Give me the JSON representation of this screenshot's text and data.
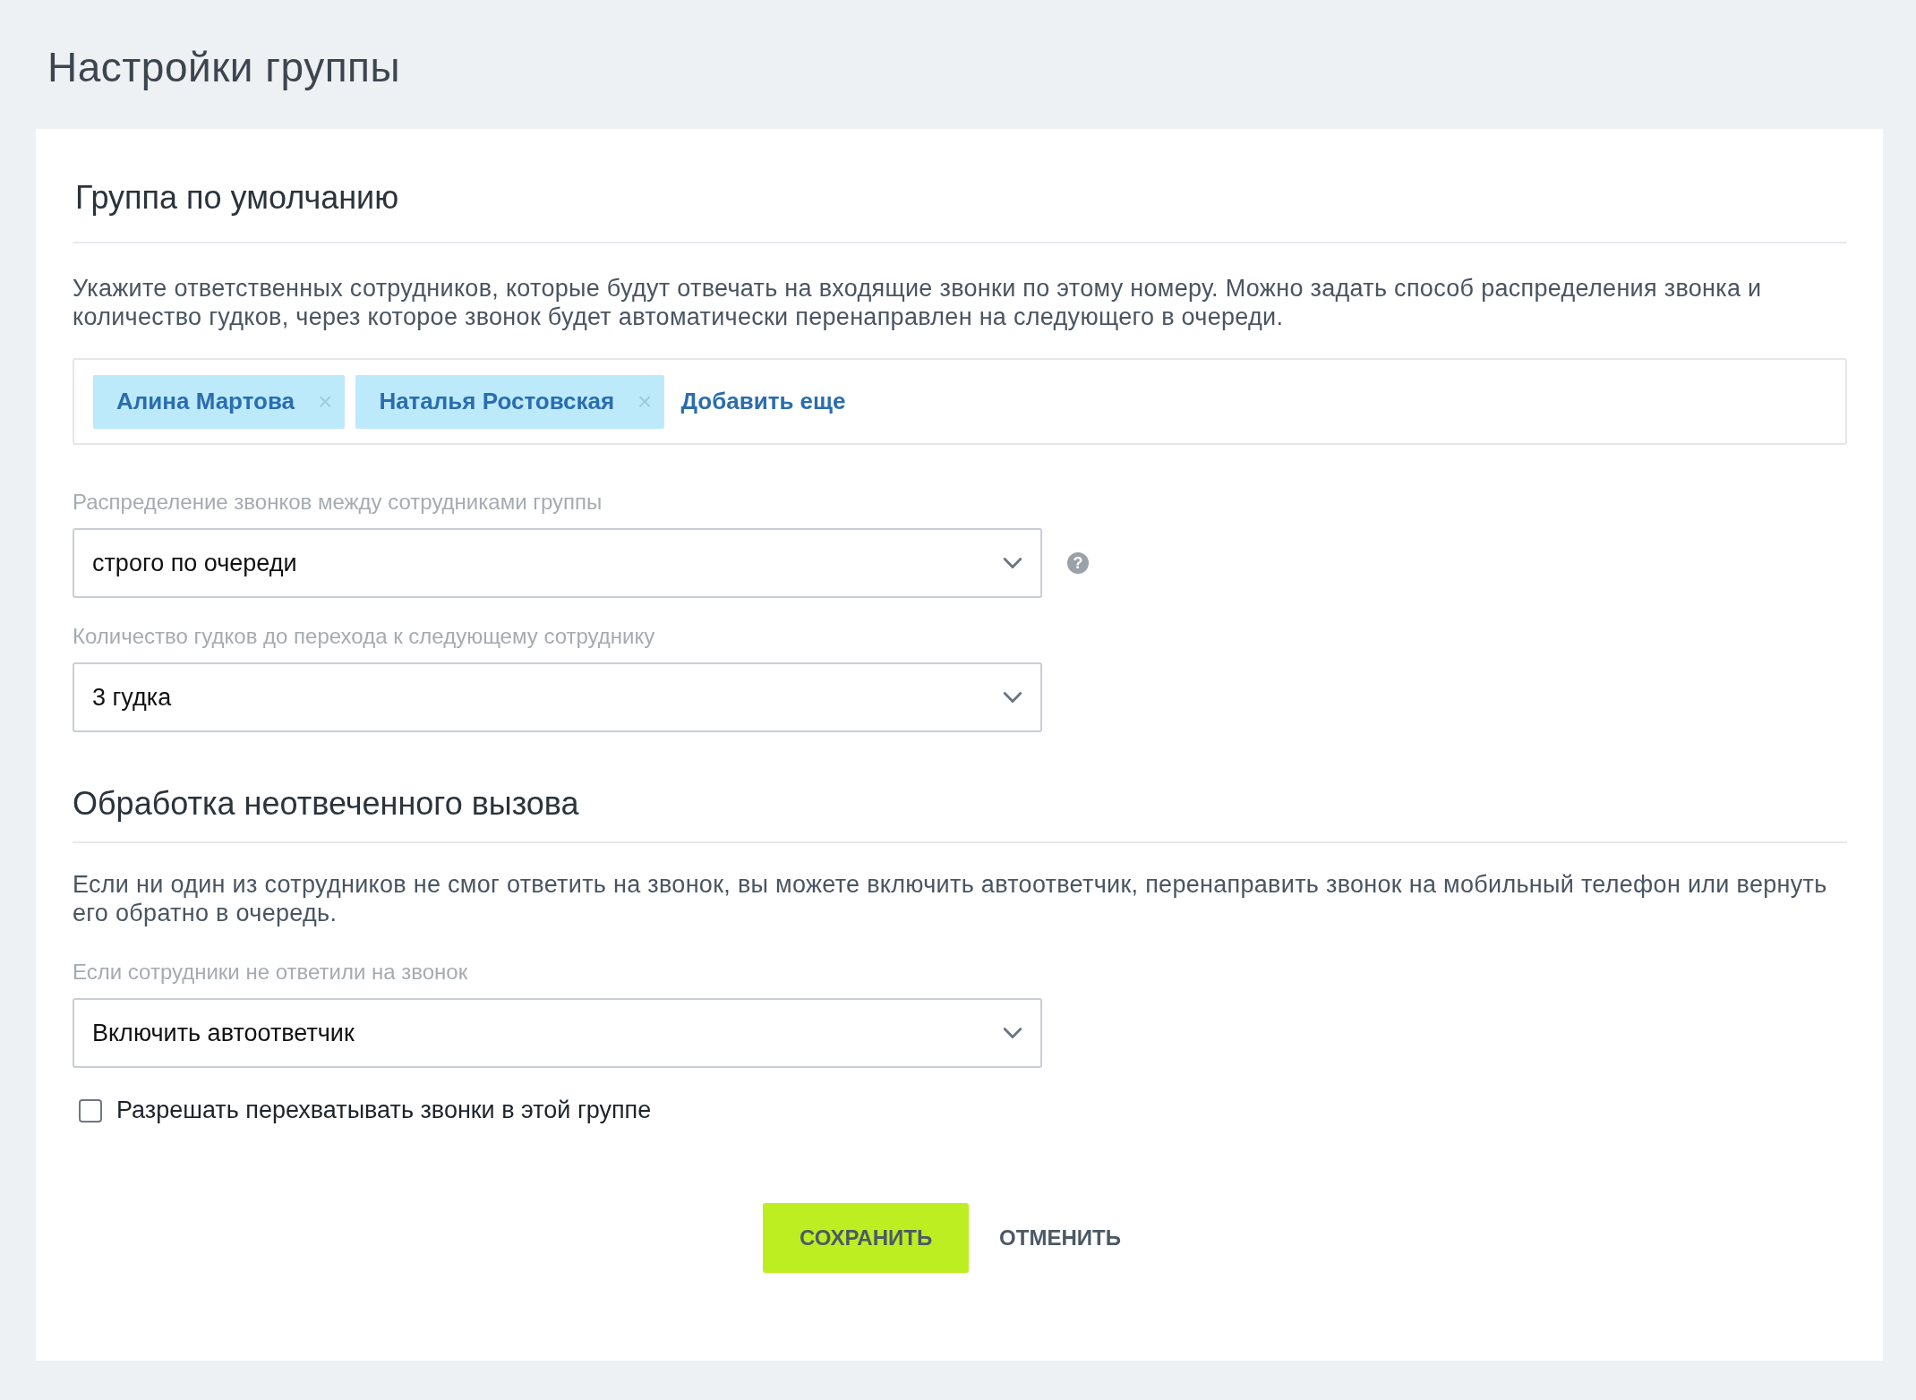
{
  "page_title": "Настройки группы",
  "sections": [
    {
      "kind": "default_group",
      "heading": "Группа по умолчанию",
      "description": "Укажите ответственных сотрудников, которые будут отвечать на входящие звонки по этому номеру. Можно задать способ распределения звонка и количество гудков, через которое звонок будет автоматически перенаправлен на следующего в очереди.",
      "employees": {
        "tags": [
          {
            "label": "Алина Мартова",
            "remove": "×"
          },
          {
            "label": "Наталья Ростовская",
            "remove": "×"
          }
        ],
        "add_link": "Добавить еще"
      },
      "fields": [
        {
          "label": "Распределение звонков между сотрудниками группы",
          "value": "строго по очереди",
          "help": "?"
        },
        {
          "label": "Количество гудков до перехода к следующему сотруднику",
          "value": "3 гудка"
        }
      ]
    },
    {
      "kind": "unanswered",
      "heading": "Обработка неотвеченного вызова",
      "description": "Если ни один из сотрудников не смог ответить на звонок, вы можете включить автоответчик, перенаправить звонок на мобильный телефон или вернуть его обратно в очередь.",
      "fields": [
        {
          "label": "Если сотрудники не ответили на звонок",
          "value": "Включить автоответчик"
        }
      ],
      "checkbox": {
        "label": "Разрешать перехватывать звонки в этой группе",
        "checked": false
      }
    }
  ],
  "buttons": [
    {
      "kind": "primary",
      "label": "СОХРАНИТЬ"
    },
    {
      "kind": "secondary",
      "label": "ОТМЕНИТЬ"
    }
  ]
}
